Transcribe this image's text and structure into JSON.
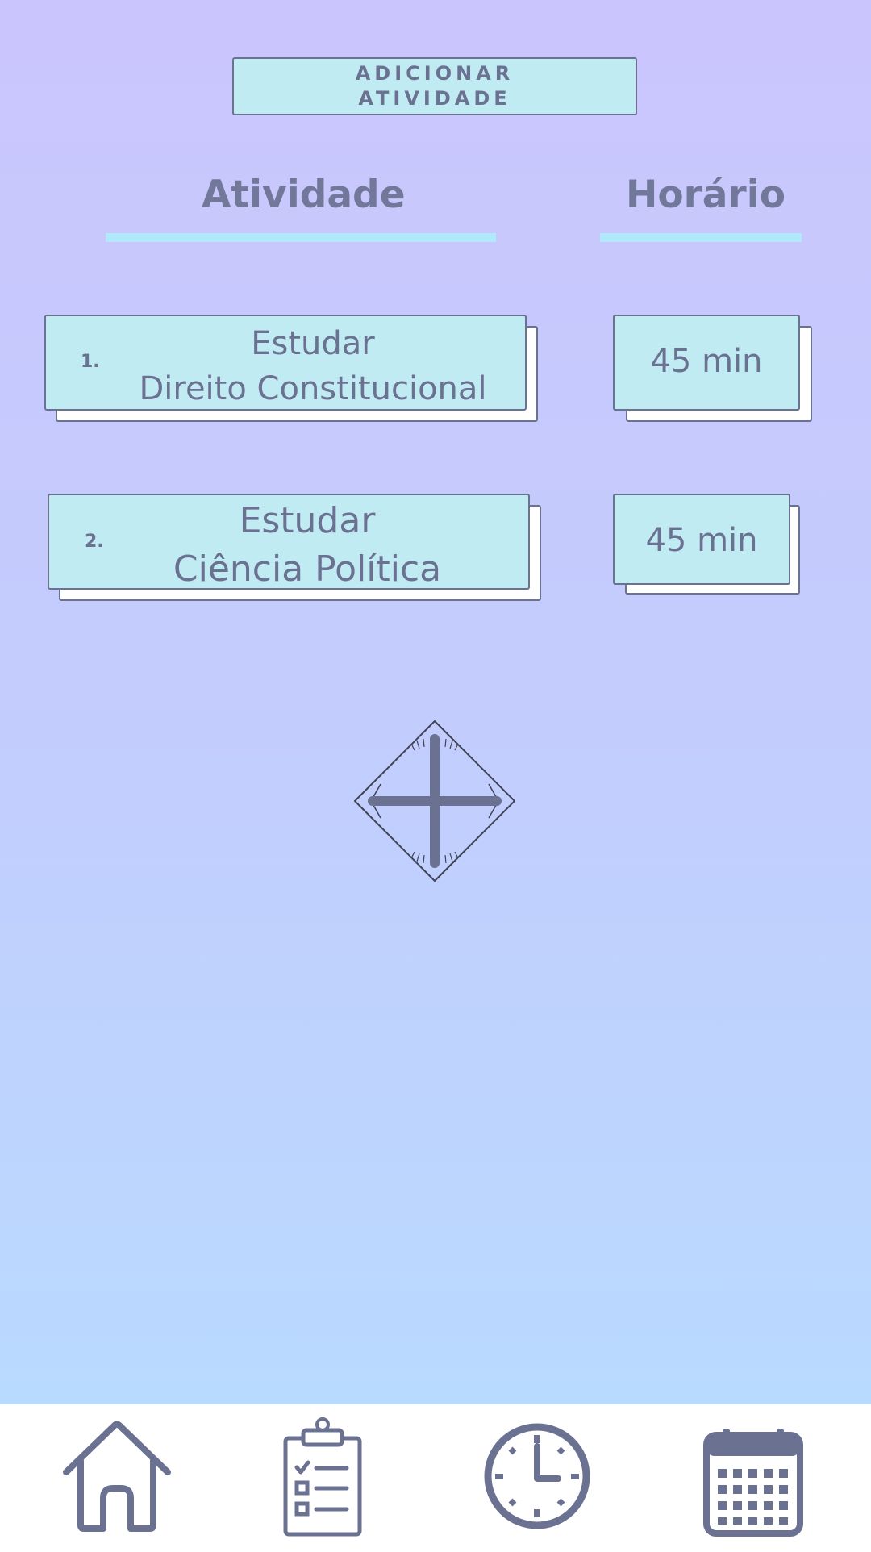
{
  "header": {
    "add_activity_label": "ADICIONAR\nATIVIDADE"
  },
  "columns": {
    "activity": "Atividade",
    "time": "Horário"
  },
  "activities": [
    {
      "number": "1.",
      "title": "Estudar\nDireito Constitucional",
      "duration": "45 min"
    },
    {
      "number": "2.",
      "title": "Estudar\nCiência Política",
      "duration": "45 min"
    }
  ],
  "add_button": {
    "icon": "plus-icon"
  },
  "bottom_nav": [
    {
      "icon": "home-icon"
    },
    {
      "icon": "clipboard-checklist-icon"
    },
    {
      "icon": "clock-icon"
    },
    {
      "icon": "calendar-icon"
    }
  ],
  "colors": {
    "background_top": "#cac6fd",
    "background_bottom": "#b9daff",
    "card": "#c0ebf3",
    "text": "#6b7190",
    "underline": "#b0e9fb"
  }
}
